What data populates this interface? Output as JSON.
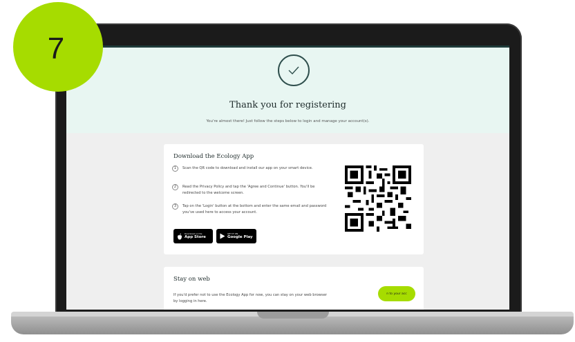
{
  "step_badge": {
    "number": "7"
  },
  "hero": {
    "title": "Thank you for registering",
    "subtitle": "You're almost there! Just follow the steps below to login and manage your account(s)."
  },
  "download_card": {
    "title": "Download the Ecology App",
    "steps": [
      {
        "num": "1",
        "text": "Scan the QR code to download and install our app on your smart device."
      },
      {
        "num": "2",
        "text": "Read the Privacy Policy and tap the 'Agree and Continue' button. You'll be redirected to the welcome screen."
      },
      {
        "num": "3",
        "text": "Tap on the 'Login' button at the bottom and enter the same email and password you've used here to access your account."
      }
    ],
    "app_store": {
      "small": "Download on the",
      "big": "App Store"
    },
    "google_play": {
      "small": "GET IT ON",
      "big": "Google Play"
    }
  },
  "web_card": {
    "title": "Stay on web",
    "text": "If you'd prefer not to use the Ecology App for now, you can stay on your web browser by logging in here.",
    "button_label": "n to your acc"
  },
  "colors": {
    "accent": "#a6dc00",
    "hero_bg": "#e8f6f2",
    "dark": "#1f3b3a"
  }
}
